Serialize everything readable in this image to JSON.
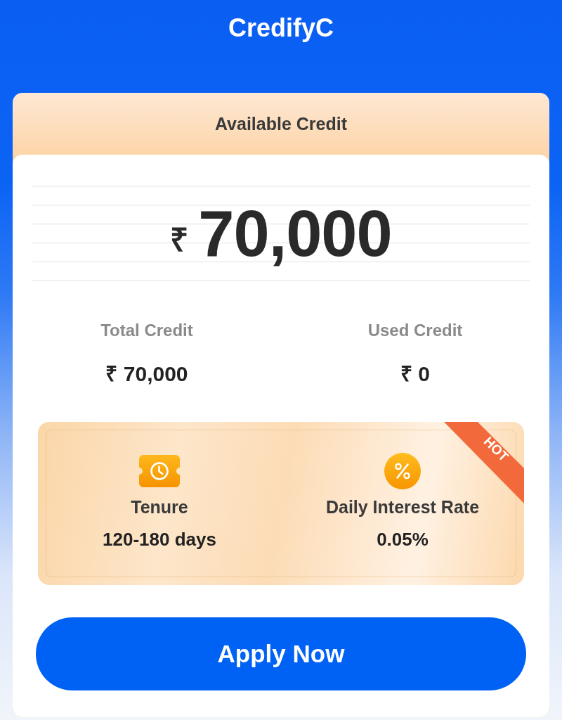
{
  "app": {
    "title": "CredifyC"
  },
  "credit": {
    "header": "Available Credit",
    "currency_symbol": "₹",
    "available_amount": "70,000",
    "stats": [
      {
        "label": "Total Credit",
        "value": "₹ 70,000"
      },
      {
        "label": "Used Credit",
        "value": "₹ 0"
      }
    ]
  },
  "offer": {
    "badge": "HOT",
    "items": [
      {
        "kind": "tenure",
        "label": "Tenure",
        "value": "120-180 days"
      },
      {
        "kind": "rate",
        "label": "Daily Interest Rate",
        "value": "0.05%"
      }
    ]
  },
  "apply_button": {
    "label": "Apply Now"
  }
}
